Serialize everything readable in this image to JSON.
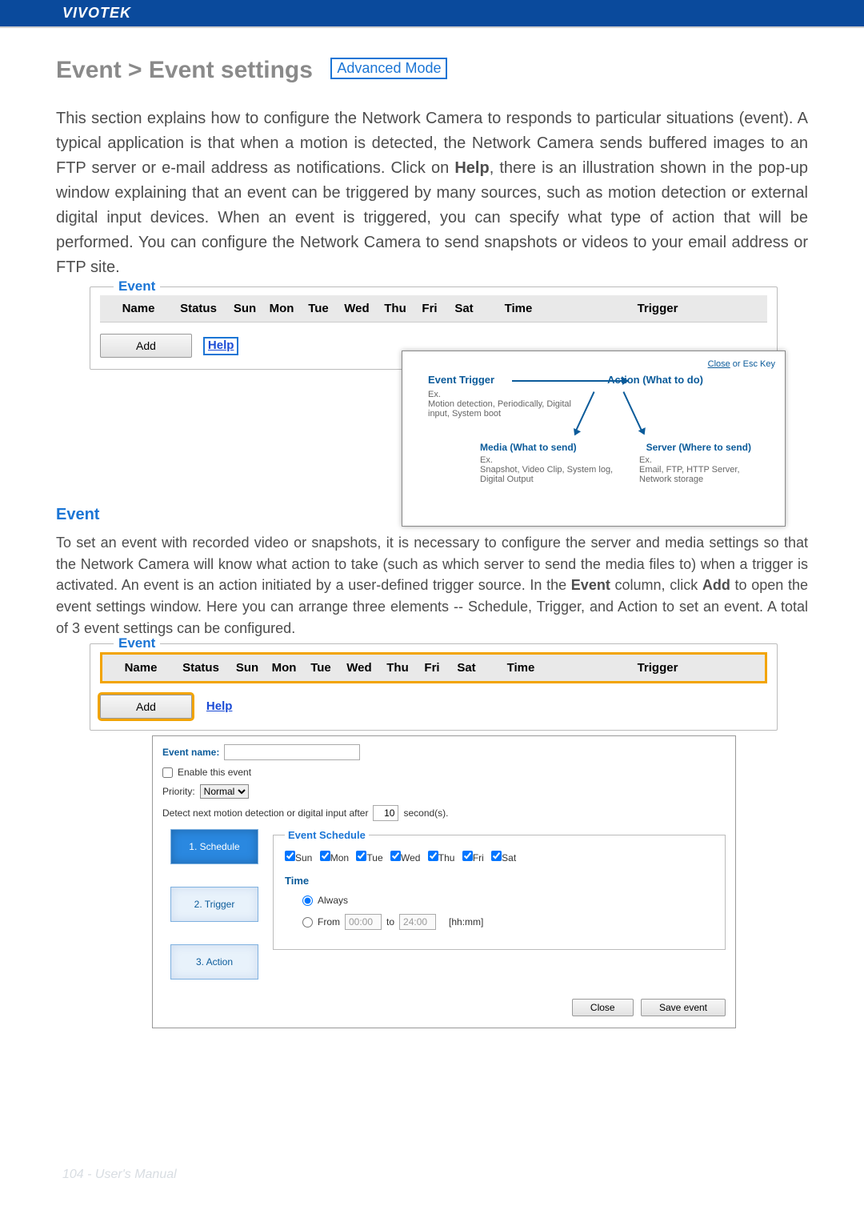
{
  "header": {
    "brand": "VIVOTEK"
  },
  "title": "Event > Event settings",
  "badge": "Advanced Mode",
  "intro_parts": {
    "p1": "This section explains how to configure the Network Camera to responds to particular situations (event). A typical application is that when a motion is detected, the Network Camera sends buffered images to an FTP server or e-mail address as notifications. Click on ",
    "help_word": "Help",
    "p2": ", there is an illustration shown in the pop-up window explaining that an event can be triggered by many sources, such as motion detection or external digital input devices. When an event is triggered, you can specify what type of action that will be performed. You can configure the Network Camera to send snapshots or videos to your email address or FTP site."
  },
  "event_table": {
    "legend": "Event",
    "headers": [
      "Name",
      "Status",
      "Sun",
      "Mon",
      "Tue",
      "Wed",
      "Thu",
      "Fri",
      "Sat",
      "Time",
      "Trigger"
    ],
    "add_label": "Add",
    "help_label": "Help"
  },
  "popup": {
    "close": "Close",
    "close_suffix": " or Esc Key",
    "trigger_title": "Event Trigger",
    "action_title": "Action (What to do)",
    "trigger_ex_label": "Ex.",
    "trigger_ex": "Motion detection, Periodically, Digital input, System boot",
    "media_title": "Media (What to send)",
    "media_ex_label": "Ex.",
    "media_ex": "Snapshot, Video Clip, System log, Digital Output",
    "server_title": "Server (Where to send)",
    "server_ex_label": "Ex.",
    "server_ex": "Email, FTP, HTTP Server, Network storage"
  },
  "section_event_heading": "Event",
  "para2_parts": {
    "p1": "To set an event with recorded video or snapshots, it is necessary to configure the server and media settings so that the Network Camera will know what action to take (such as which server to send the media files to) when a trigger is activated. An event is an action initiated by a user-defined trigger source. In the ",
    "ev": "Event",
    "p2": "  column, click ",
    "add": "Add",
    "p3": " to open the event settings window. Here you can arrange three elements -- Schedule, Trigger, and Action to set an event. A total of 3 event settings can be configured."
  },
  "settings": {
    "event_name_label": "Event name:",
    "enable_label": "Enable this event",
    "priority_label": "Priority:",
    "priority_value": "Normal",
    "detect_label_pre": "Detect next motion detection or digital input after",
    "detect_value": "10",
    "detect_label_post": "second(s).",
    "steps": {
      "s1": "1. Schedule",
      "s2": "2. Trigger",
      "s3": "3. Action"
    },
    "schedule": {
      "legend": "Event Schedule",
      "days": [
        "Sun",
        "Mon",
        "Tue",
        "Wed",
        "Thu",
        "Fri",
        "Sat"
      ],
      "time_label": "Time",
      "always_label": "Always",
      "from_label": "From",
      "from_value": "00:00",
      "to_label": "to",
      "to_value": "24:00",
      "hhmm": "[hh:mm]"
    },
    "buttons": {
      "close": "Close",
      "save": "Save event"
    }
  },
  "footer": "104 - User's Manual"
}
